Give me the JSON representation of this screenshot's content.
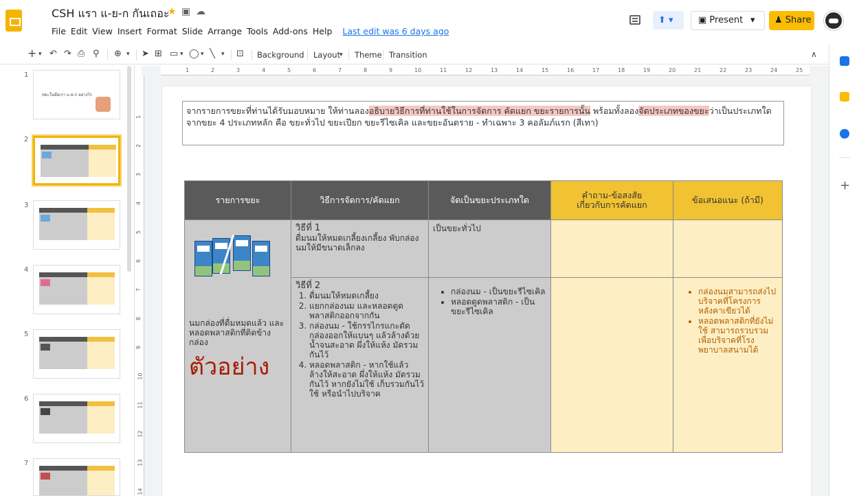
{
  "header": {
    "title": "CSH แรา แ-ย-ก กันเถอะ",
    "menus": [
      "File",
      "Edit",
      "View",
      "Insert",
      "Format",
      "Slide",
      "Arrange",
      "Tools",
      "Add-ons",
      "Help"
    ],
    "last_edit": "Last edit was 6 days ago",
    "present_label": "Present",
    "share_label": "Share"
  },
  "toolbar": {
    "background": "Background",
    "layout": "Layout",
    "theme": "Theme",
    "transition": "Transition"
  },
  "filmstrip": {
    "slide_numbers": [
      "1",
      "2",
      "3",
      "4",
      "5",
      "6",
      "7"
    ],
    "selected": 2,
    "slide1_title": "ขยะในมือเรา แ-ย-ก อย่างไร"
  },
  "ruler": {
    "h_ticks": [
      "1",
      "2",
      "3",
      "4",
      "5",
      "6",
      "7",
      "8",
      "9",
      "10",
      "11",
      "12",
      "13",
      "14",
      "15",
      "16",
      "17",
      "18",
      "19",
      "20",
      "21",
      "22",
      "23",
      "24",
      "25"
    ],
    "v_ticks": [
      "1",
      "2",
      "3",
      "4",
      "5",
      "6",
      "7",
      "8",
      "9",
      "10",
      "11",
      "12",
      "13",
      "14"
    ]
  },
  "slide": {
    "instruction_pre": "จากรายการขยะที่ท่านได้รับมอบหมาย ให้ท่านลอง",
    "instruction_hl1": "อธิบายวิธีการที่ท่านใช้ในการจัดการ คัดแยก ขยะรายการนั้น",
    "instruction_mid": " พร้อมทั้งลอง",
    "instruction_hl2": "จัดประเภทของขยะ",
    "instruction_post": "ว่าเป็นประเภทใดจากขยะ 4 ประเภทหลัก คือ ขยะทั่วไป ขยะเปียก ขยะรีไซเคิล และขยะอันตราย - ทำเฉพาะ 3 คอลัมภ์แรก (สีเทา)",
    "columns": [
      "รายการขยะ",
      "วิธีการจัดการ/คัดแยก",
      "จัดเป็นขยะประเภทใด",
      "คำถาม-ข้อสงสัย\nเกี่ยวกับการคัดแยก",
      "ข้อเสนอแนะ (ถ้ามี)"
    ],
    "item_label": "นมกล่องที่ดื่มหมดแล้ว และหลอดพลาสติกที่ติดข้างกล่อง",
    "example_label": "ตัวอย่าง",
    "method1_title": "วิธีที่ 1",
    "method1_text": "ดื่มนมให้หมดเกลี้ยงเกลี้ยง พับกล่องนมให้มีขนาดเล็กลง",
    "type1": "เป็นขยะทั่วไป",
    "method2_title": "วิธีที่ 2",
    "method2_steps": [
      "ดื่มนมให้หมดเกลี้ยง",
      "แยกกล่องนม และหลอดดูดพลาสติกออกจากกัน",
      "กล่องนม - ใช้กรรไกรแกะตัดกล่องออกให้แบนๆ แล้วล้างด้วยน้ำจนสะอาด ผึ่งให้แห้ง มัดรวมกันไว้",
      "หลอดพลาสติก - หากใช้แล้ว ล้างให้สะอาด ผึ่งให้แห้ง มัดรวมกันไว้ หากยังไม่ใช้ เก็บรวมกันไว้ใช้ หรือนำไปบริจาค"
    ],
    "type2": [
      "กล่องนม - เป็นขยะรีไซเคิล",
      "หลอดดูดพลาสติก - เป็นขยะรีไซเคิล"
    ],
    "suggestions": [
      "กล่องนมสามารถส่งไปบริจาคที่โครงการหลังคาเขียวได้",
      "หลอดพลาสติกที่ยังไม่ใช้ สามารถรวบรวมเพื่อบริจาคที่โรงพยาบาลสนามได้"
    ]
  }
}
